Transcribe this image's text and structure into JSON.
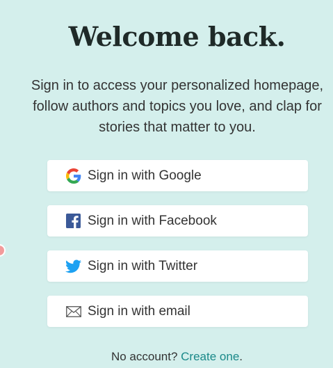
{
  "page": {
    "title": "Welcome back.",
    "subtitle": "Sign in to access your personalized homepage, follow authors and topics you love, and clap for stories that matter to you."
  },
  "buttons": [
    {
      "label": "Sign in with Google",
      "icon": "google-icon"
    },
    {
      "label": "Sign in with Facebook",
      "icon": "facebook-icon"
    },
    {
      "label": "Sign in with Twitter",
      "icon": "twitter-icon"
    },
    {
      "label": "Sign in with email",
      "icon": "email-icon"
    }
  ],
  "footer": {
    "prompt": "No account? ",
    "link": "Create one",
    "suffix": "."
  },
  "colors": {
    "background": "#d4efec",
    "link": "#1a8989",
    "facebook": "#3b5998",
    "twitter": "#1da1f2"
  }
}
